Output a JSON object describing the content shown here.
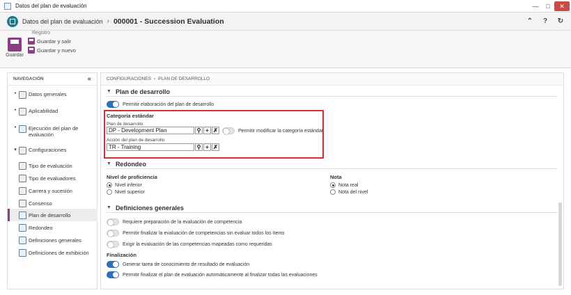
{
  "window": {
    "title": "Datos del plan de evaluación"
  },
  "header": {
    "crumb": "Datos del plan de evaluación",
    "separator": "›",
    "title": "000001 - Succession Evaluation"
  },
  "ribbon": {
    "group_label": "Registro",
    "save_label": "Guardar",
    "save_exit_label": "Guardar y salir",
    "save_new_label": "Guardar y nuevo"
  },
  "sidebar": {
    "title": "NAVEGACIÓN",
    "items": [
      {
        "label": "Datos generales"
      },
      {
        "label": "Aplicabilidad"
      },
      {
        "label": "Ejecución del plan de evaluación"
      },
      {
        "label": "Configuraciones"
      }
    ],
    "subitems": [
      {
        "label": "Tipo de evaluación"
      },
      {
        "label": "Tipo de evaluadores"
      },
      {
        "label": "Carrera y sucesión"
      },
      {
        "label": "Consenso"
      },
      {
        "label": "Plan de desarrollo"
      },
      {
        "label": "Redondeo"
      },
      {
        "label": "Definiciones generales"
      },
      {
        "label": "Definiciones de exhibición"
      }
    ]
  },
  "main": {
    "breadcrumb": [
      "CONFIGURACIONES",
      "PLAN DE DESARROLLO"
    ],
    "plan_section": {
      "title": "Plan de desarrollo",
      "allow_label": "Permitir elaboración del plan de desarrollo",
      "category_title": "Categoría estándar",
      "plan_label": "Plan de desarrollo",
      "plan_value": "DP - Development Plan",
      "allow_modify_label": "Permitir modificar la categoría estándar",
      "action_label": "Acción del plan de desarrollo",
      "action_value": "TR - Training"
    },
    "rounding_section": {
      "title": "Redondeo",
      "proficiency_title": "Nivel de proficiencia",
      "prof_options": [
        "Nivel inferior",
        "Nivel superior"
      ],
      "grade_title": "Nota",
      "grade_options": [
        "Nota real",
        "Nota del nivel"
      ]
    },
    "general_section": {
      "title": "Definiciones generales",
      "options": [
        "Requiere preparación de la evaluación de competencia",
        "Permitir finalizar la evaluación de competencias sin evaluar todos los ítems",
        "Exigir la evaluación de las competencias mapeadas como requeridas"
      ],
      "final_title": "Finalización",
      "final_options": [
        "Generar tarea de conocimiento de resultado de evaluación",
        "Permitir finalizar el plan de evaluación automáticamente al finalizar todas las evaluaciones"
      ]
    }
  },
  "colors": {
    "accent": "#8e3d82",
    "toggle_on": "#2e6fb7",
    "highlight": "#d0312d"
  }
}
